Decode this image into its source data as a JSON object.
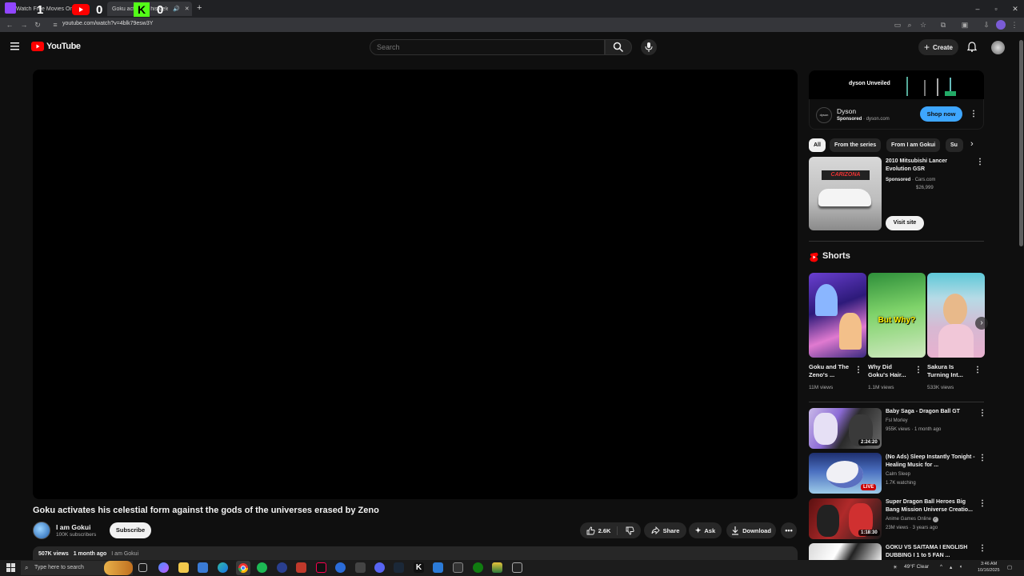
{
  "browser": {
    "tabs": [
      {
        "label": "Watch Free Movies Online"
      },
      {
        "label": "Goku activates his celestial form"
      }
    ],
    "overlay_scores": {
      "twitch": "1",
      "youtube": "0",
      "kick": "0"
    },
    "url": "youtube.com/watch?v=4blk79esw3Y"
  },
  "header": {
    "logo_text": "YouTube",
    "search_placeholder": "Search",
    "create_label": "Create"
  },
  "video": {
    "title": "Goku activates his celestial form against the gods of the universes erased by Zeno",
    "channel_name": "I am Gokui",
    "subscribers": "100K subscribers",
    "subscribe_label": "Subscribe",
    "likes": "2.6K",
    "share_label": "Share",
    "ask_label": "Ask",
    "download_label": "Download",
    "views": "507K views",
    "posted": "1 month ago",
    "desc_channel": "I am Gokui"
  },
  "sidebar": {
    "ad": {
      "banner_text": "dyson Unveiled",
      "name": "Dyson",
      "sponsored": "Sponsored",
      "domain": "dyson.com",
      "logo_text": "dyson",
      "cta": "Shop now"
    },
    "chips": [
      "All",
      "From the series",
      "From I am Gokui",
      "Su"
    ],
    "sponsored_video": {
      "title": "2010 Mitsubishi Lancer Evolution GSR",
      "sponsored": "Sponsored",
      "advertiser": "Cars.com",
      "price": "$26,999",
      "thumb_text": "CARIZONA",
      "cta": "Visit site"
    },
    "shorts_heading": "Shorts",
    "shorts": [
      {
        "title": "Goku and The Zeno's ...",
        "views": "11M views",
        "thumb_text": ""
      },
      {
        "title": "Why Did Goku's Hair...",
        "views": "1.1M views",
        "thumb_text": "But Why?"
      },
      {
        "title": "Sakura Is Turning Int...",
        "views": "533K views",
        "thumb_text": ""
      }
    ],
    "videos": [
      {
        "title": "Baby Saga - Dragon Ball GT",
        "channel": "Fsl Morley",
        "meta": "955K views · 1 month ago",
        "badge": "2:24:20"
      },
      {
        "title": "(No Ads) Sleep Instantly Tonight - Healing Music for ...",
        "channel": "Calm Sleep",
        "meta": "1.7K watching",
        "badge": "LIVE"
      },
      {
        "title": "Super Dragon Ball Heroes Big Bang Mission Universe Creatio...",
        "channel": "Anime Games Online",
        "meta": "23M views · 3 years ago",
        "badge": "1:18:30"
      },
      {
        "title": "GOKU VS SAITAMA I ENGLISH DUBBING I 1 to 5 FAN ...",
        "channel": "",
        "meta": "",
        "badge": ""
      }
    ]
  },
  "taskbar": {
    "search_placeholder": "Type here to search",
    "weather": "49°F  Clear",
    "time": "3:46 AM",
    "date": "10/16/2025"
  }
}
